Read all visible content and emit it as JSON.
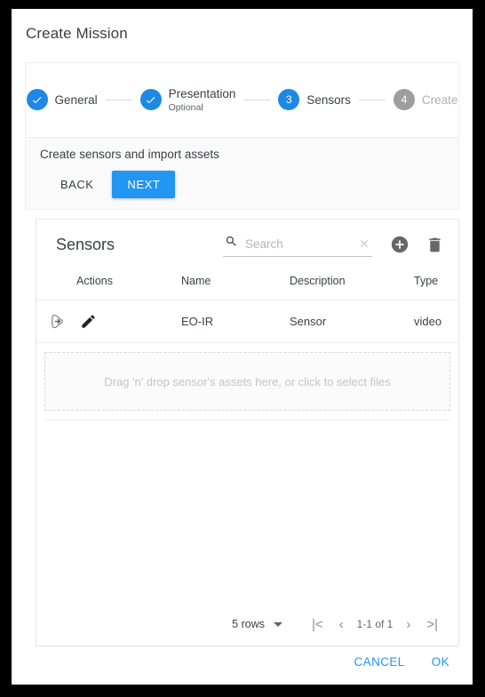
{
  "dialog": {
    "title": "Create Mission"
  },
  "stepper": {
    "steps": [
      {
        "index": "1",
        "label": "General",
        "sub": "",
        "state": "done",
        "glyph": "check"
      },
      {
        "index": "2",
        "label": "Presentation",
        "sub": "Optional",
        "state": "done",
        "glyph": "check"
      },
      {
        "index": "3",
        "label": "Sensors",
        "sub": "",
        "state": "active",
        "glyph": "3"
      },
      {
        "index": "4",
        "label": "Create",
        "sub": "",
        "state": "idle",
        "glyph": "4"
      }
    ],
    "caption": "Create sensors and import assets",
    "back_label": "BACK",
    "next_label": "NEXT"
  },
  "sensors_card": {
    "heading": "Sensors",
    "search": {
      "placeholder": "Search",
      "value": "",
      "search_icon": "search-icon",
      "clear_icon": "close-icon"
    },
    "add_icon": "add-circle-icon",
    "delete_icon": "trash-icon",
    "table": {
      "columns": [
        "Actions",
        "Name",
        "Description",
        "Type"
      ],
      "rows": [
        {
          "actions": [
            "import-arrow-icon",
            "edit-pencil-icon"
          ],
          "name": "EO-IR",
          "description": "Sensor",
          "type": "video"
        }
      ]
    },
    "dropzone": {
      "text": "Drag 'n' drop sensor's assets here, or click to select files"
    },
    "pagination": {
      "rows_label": "5 rows",
      "range": "1-1 of 1",
      "first_label": "|<",
      "prev_label": "‹",
      "next_label": "›",
      "last_label": ">|"
    }
  },
  "footer": {
    "cancel_label": "CANCEL",
    "ok_label": "OK"
  },
  "colors": {
    "accent": "#2196f3",
    "step_done": "#1e88e5",
    "step_idle": "#9e9e9e",
    "text": "#3c4043",
    "muted": "#b0b0b0"
  }
}
